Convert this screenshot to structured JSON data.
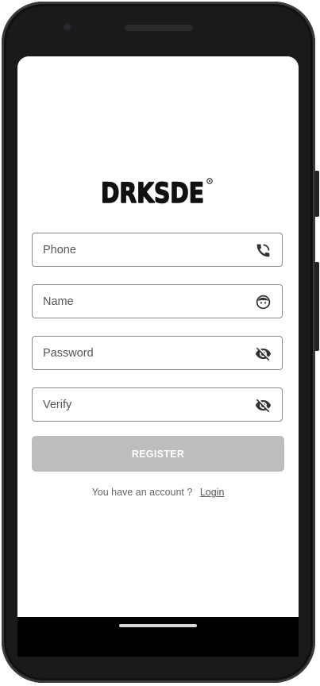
{
  "app": {
    "logo_text": "DRKSDE"
  },
  "form": {
    "phone": {
      "placeholder": "Phone",
      "value": ""
    },
    "name": {
      "placeholder": "Name",
      "value": ""
    },
    "password": {
      "placeholder": "Password",
      "value": ""
    },
    "verify": {
      "placeholder": "Verify",
      "value": ""
    },
    "register_label": "REGISTER"
  },
  "footer": {
    "prompt": "You have an account ?",
    "login_label": "Login"
  },
  "icons": {
    "phone": "phone-icon",
    "name": "face-icon",
    "password": "visibility-off-icon",
    "verify": "visibility-off-icon"
  },
  "colors": {
    "button_disabled": "#bdbdbd",
    "field_border": "#8a8a8a"
  }
}
